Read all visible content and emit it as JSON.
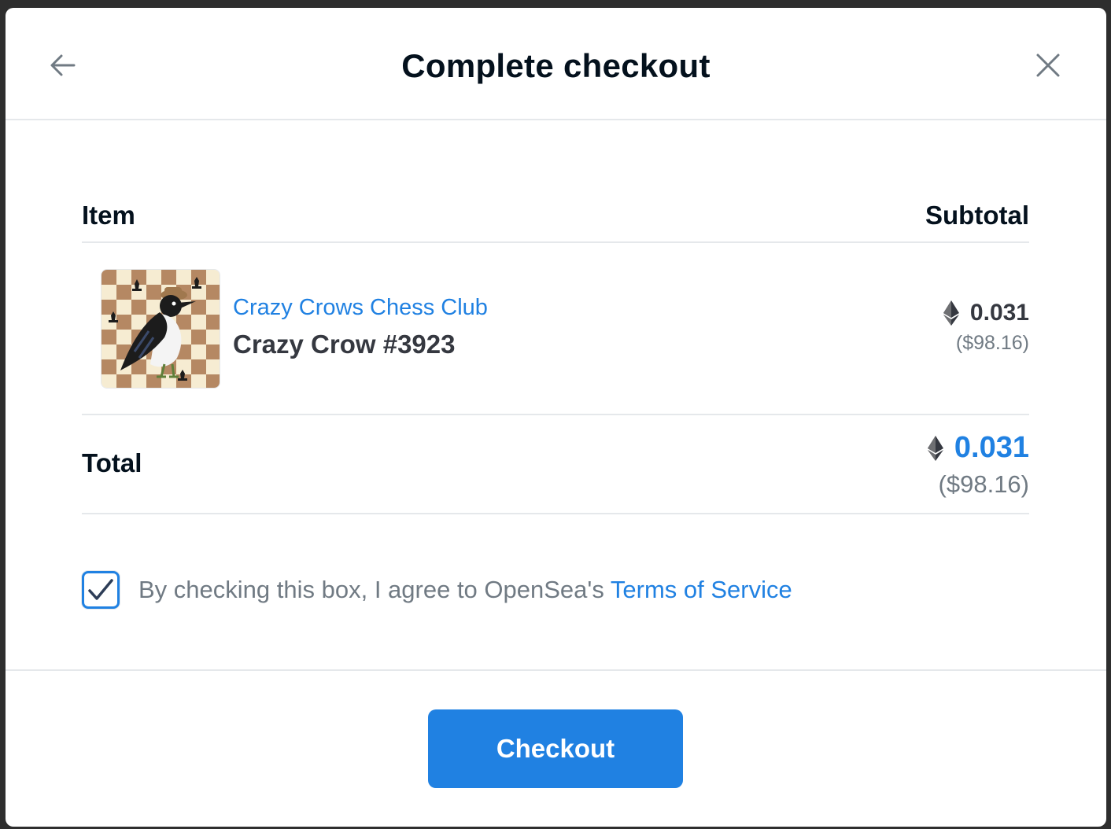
{
  "modal": {
    "title": "Complete checkout"
  },
  "icons": {
    "back": "arrow-left-icon",
    "close": "close-icon",
    "eth": "ethereum-icon",
    "check": "checkmark-icon"
  },
  "table": {
    "item_header": "Item",
    "subtotal_header": "Subtotal"
  },
  "item": {
    "collection": "Crazy Crows Chess Club",
    "name": "Crazy Crow #3923",
    "price_eth": "0.031",
    "price_usd": "($98.16)"
  },
  "total": {
    "label": "Total",
    "price_eth": "0.031",
    "price_usd": "($98.16)"
  },
  "agreement": {
    "checked": true,
    "text": "By checking this box, I agree to OpenSea's ",
    "link": "Terms of Service"
  },
  "footer": {
    "checkout_label": "Checkout"
  },
  "colors": {
    "accent": "#2081e2",
    "text_primary": "#04111d",
    "text_secondary": "#707a83",
    "divider": "#e5e8eb",
    "board_dark": "#b58863",
    "board_light": "#f6ecd2"
  }
}
